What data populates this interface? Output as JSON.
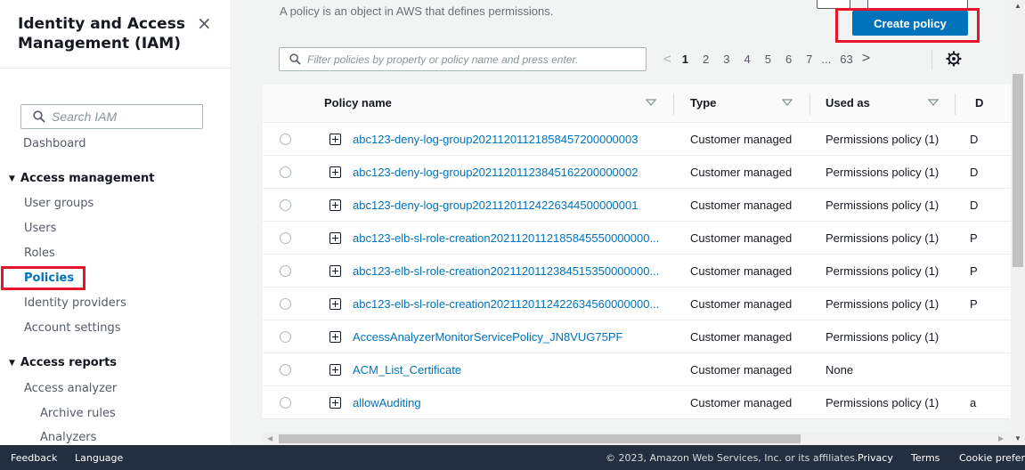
{
  "sidebar": {
    "title": "Identity and Access Management (IAM)",
    "close_icon": "×",
    "search_placeholder": "Search IAM",
    "dashboard": "Dashboard",
    "access_management": "Access management",
    "items": [
      "User groups",
      "Users",
      "Roles",
      "Policies",
      "Identity providers",
      "Account settings"
    ],
    "access_reports": "Access reports",
    "reports": [
      "Access analyzer",
      "Archive rules",
      "Analyzers"
    ]
  },
  "main": {
    "description": "A policy is an object in AWS that defines permissions.",
    "create_button": "Create policy",
    "filter_placeholder": "Filter policies by property or policy name and press enter.",
    "pagination": {
      "pages": [
        "1",
        "2",
        "3",
        "4",
        "5",
        "6",
        "7",
        "...",
        "63"
      ],
      "current": "1"
    },
    "columns": [
      "Policy name",
      "Type",
      "Used as",
      "D"
    ],
    "rows": [
      {
        "name": "abc123-deny-log-group20211201121858457200000003",
        "type": "Customer managed",
        "used_as": "Permissions policy (1)",
        "desc": "D"
      },
      {
        "name": "abc123-deny-log-group20211201123845162200000002",
        "type": "Customer managed",
        "used_as": "Permissions policy (1)",
        "desc": "D"
      },
      {
        "name": "abc123-deny-log-group20211201124226344500000001",
        "type": "Customer managed",
        "used_as": "Permissions policy (1)",
        "desc": "D"
      },
      {
        "name": "abc123-elb-sl-role-creation2021120112185845550000000...",
        "type": "Customer managed",
        "used_as": "Permissions policy (1)",
        "desc": "P"
      },
      {
        "name": "abc123-elb-sl-role-creation2021120112384515350000000...",
        "type": "Customer managed",
        "used_as": "Permissions policy (1)",
        "desc": "P"
      },
      {
        "name": "abc123-elb-sl-role-creation2021120112422634560000000...",
        "type": "Customer managed",
        "used_as": "Permissions policy (1)",
        "desc": "P"
      },
      {
        "name": "AccessAnalyzerMonitorServicePolicy_JN8VUG75PF",
        "type": "Customer managed",
        "used_as": "Permissions policy (1)",
        "desc": ""
      },
      {
        "name": "ACM_List_Certificate",
        "type": "Customer managed",
        "used_as": "None",
        "desc": ""
      },
      {
        "name": "allowAuditing",
        "type": "Customer managed",
        "used_as": "Permissions policy (1)",
        "desc": "a"
      }
    ]
  },
  "footer": {
    "feedback": "Feedback",
    "language": "Language",
    "copyright": "© 2023, Amazon Web Services, Inc. or its affiliates.",
    "privacy": "Privacy",
    "terms": "Terms",
    "cookie": "Cookie prefere"
  },
  "colors": {
    "accent": "#0073bb",
    "highlight": "#e8142b",
    "footer_bg": "#232f3e"
  }
}
